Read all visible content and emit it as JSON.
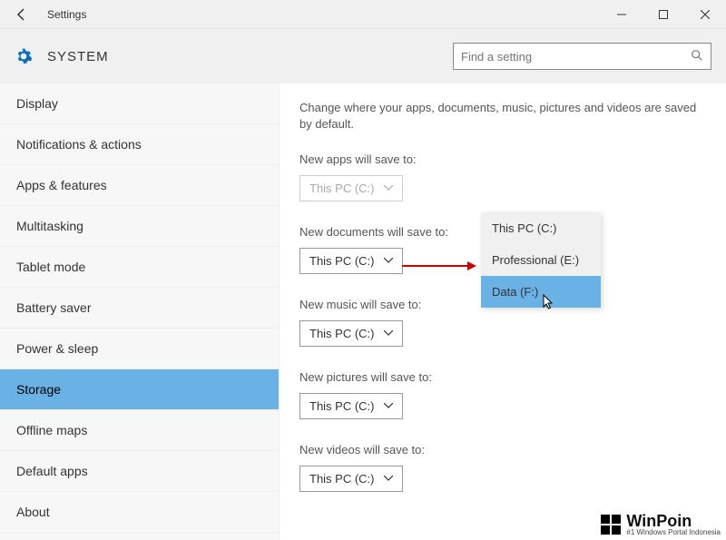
{
  "titlebar": {
    "title": "Settings"
  },
  "header": {
    "title": "SYSTEM",
    "search_placeholder": "Find a setting"
  },
  "sidebar": {
    "items": [
      {
        "label": "Display"
      },
      {
        "label": "Notifications & actions"
      },
      {
        "label": "Apps & features"
      },
      {
        "label": "Multitasking"
      },
      {
        "label": "Tablet mode"
      },
      {
        "label": "Battery saver"
      },
      {
        "label": "Power & sleep"
      },
      {
        "label": "Storage"
      },
      {
        "label": "Offline maps"
      },
      {
        "label": "Default apps"
      },
      {
        "label": "About"
      }
    ],
    "active_index": 7
  },
  "main": {
    "description": "Change where your apps, documents, music, pictures and videos are saved by default.",
    "sections": [
      {
        "label": "New apps will save to:",
        "value": "This PC (C:)",
        "disabled": true
      },
      {
        "label": "New documents will save to:",
        "value": "This PC (C:)",
        "disabled": false
      },
      {
        "label": "New music will save to:",
        "value": "This PC (C:)",
        "disabled": false
      },
      {
        "label": "New pictures will save to:",
        "value": "This PC (C:)",
        "disabled": false
      },
      {
        "label": "New videos will save to:",
        "value": "This PC (C:)",
        "disabled": false
      }
    ],
    "popup": {
      "options": [
        {
          "label": "This PC (C:)"
        },
        {
          "label": "Professional (E:)"
        },
        {
          "label": "Data (F:)"
        }
      ],
      "hover_index": 2
    }
  },
  "watermark": {
    "main": "WinPoin",
    "sub": "#1 Windows Portal Indonesia"
  }
}
